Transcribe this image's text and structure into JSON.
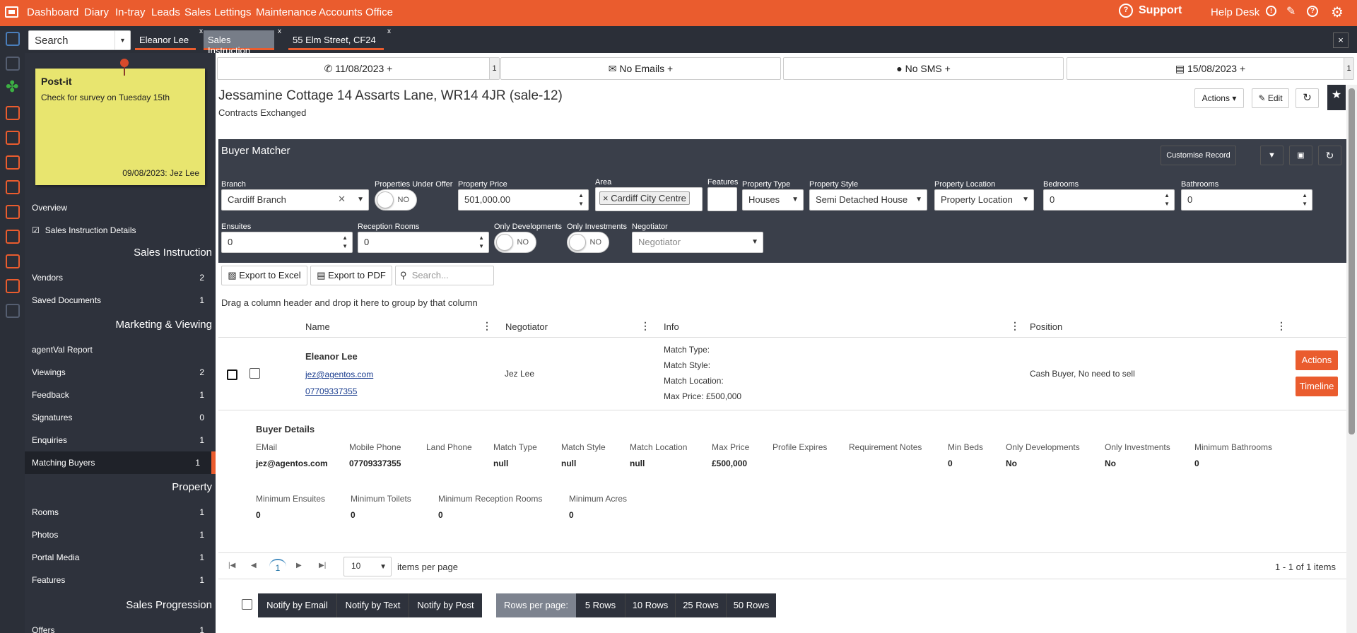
{
  "topnav": {
    "items": [
      "Dashboard",
      "Diary",
      "In-tray",
      "Leads",
      "Sales",
      "Lettings",
      "Maintenance",
      "Accounts",
      "Office"
    ],
    "support": "Support",
    "help_desk": "Help Desk"
  },
  "tabs": {
    "search_placeholder": "Search",
    "items": [
      "Eleanor Lee",
      "Sales Instruction",
      "55 Elm Street, CF24"
    ],
    "close_all": "×"
  },
  "postit": {
    "title": "Post-it",
    "text": "Check for survey on Tuesday 15th",
    "footer": "09/08/2023: Jez Lee"
  },
  "sidebar": {
    "top": [
      {
        "label": "Overview"
      },
      {
        "label": "Sales Instruction Details"
      }
    ],
    "sections": [
      {
        "title": "Sales Instruction",
        "items": [
          {
            "label": "Vendors",
            "count": "2"
          },
          {
            "label": "Saved Documents",
            "count": "1"
          }
        ]
      },
      {
        "title": "Marketing & Viewing",
        "items": [
          {
            "label": "agentVal Report",
            "count": ""
          },
          {
            "label": "Viewings",
            "count": "2"
          },
          {
            "label": "Feedback",
            "count": "1"
          },
          {
            "label": "Signatures",
            "count": "0"
          },
          {
            "label": "Enquiries",
            "count": "1"
          },
          {
            "label": "Matching Buyers",
            "count": "1"
          }
        ]
      },
      {
        "title": "Property",
        "items": [
          {
            "label": "Rooms",
            "count": "1"
          },
          {
            "label": "Photos",
            "count": "1"
          },
          {
            "label": "Portal Media",
            "count": "1"
          },
          {
            "label": "Features",
            "count": "1"
          }
        ]
      },
      {
        "title": "Sales Progression",
        "items": [
          {
            "label": "Offers",
            "count": "1"
          }
        ]
      }
    ]
  },
  "actionbar": {
    "call": "11/08/2023 +",
    "call_count": "1",
    "emails": "No Emails +",
    "sms": "No SMS +",
    "diary": "15/08/2023 +",
    "diary_count": "1"
  },
  "property": {
    "title": "Jessamine Cottage 14 Assarts Lane, WR14 4JR (sale-12)",
    "status": "Contracts Exchanged",
    "actions": "Actions",
    "edit": "Edit"
  },
  "matcher": {
    "title": "Buyer Matcher",
    "customise": "Customise Record",
    "filters": {
      "branch": {
        "label": "Branch",
        "value": "Cardiff Branch"
      },
      "under_offer": {
        "label": "Properties Under Offer",
        "value": "NO"
      },
      "price": {
        "label": "Property Price",
        "value": "501,000.00"
      },
      "area": {
        "label": "Area",
        "value": "Cardiff City Centre"
      },
      "features": {
        "label": "Features",
        "value": ""
      },
      "type": {
        "label": "Property Type",
        "value": "Houses"
      },
      "style": {
        "label": "Property Style",
        "value": "Semi Detached House"
      },
      "location": {
        "label": "Property Location",
        "value": "Property Location"
      },
      "bedrooms": {
        "label": "Bedrooms",
        "value": "0"
      },
      "bathrooms": {
        "label": "Bathrooms",
        "value": "0"
      },
      "ensuites": {
        "label": "Ensuites",
        "value": "0"
      },
      "reception": {
        "label": "Reception Rooms",
        "value": "0"
      },
      "only_dev": {
        "label": "Only Developments",
        "value": "NO"
      },
      "only_inv": {
        "label": "Only Investments",
        "value": "NO"
      },
      "negotiator": {
        "label": "Negotiator",
        "value": "Negotiator"
      }
    }
  },
  "toolbar": {
    "excel": "Export to Excel",
    "pdf": "Export to PDF",
    "search_placeholder": "Search...",
    "drag_hint": "Drag a column header and drop it here to group by that column"
  },
  "grid": {
    "columns": [
      "Name",
      "Negotiator",
      "Info",
      "Position"
    ],
    "row": {
      "name": "Eleanor Lee",
      "email": "jez@agentos.com",
      "phone": "07709337355",
      "negotiator": "Jez Lee",
      "info": [
        "Match Type:",
        "Match Style:",
        "Match Location:",
        "Max Price: £500,000"
      ],
      "position": "Cash Buyer, No need to sell",
      "actions": "Actions",
      "timeline": "Timeline"
    }
  },
  "buyer_details": {
    "title": "Buyer Details",
    "row1": [
      {
        "label": "EMail",
        "value": "jez@agentos.com"
      },
      {
        "label": "Mobile Phone",
        "value": "07709337355"
      },
      {
        "label": "Land Phone",
        "value": ""
      },
      {
        "label": "Match Type",
        "value": "null"
      },
      {
        "label": "Match Style",
        "value": "null"
      },
      {
        "label": "Match Location",
        "value": "null"
      },
      {
        "label": "Max Price",
        "value": "£500,000"
      },
      {
        "label": "Profile Expires",
        "value": ""
      },
      {
        "label": "Requirement Notes",
        "value": ""
      },
      {
        "label": "Min Beds",
        "value": "0"
      },
      {
        "label": "Only Developments",
        "value": "No"
      },
      {
        "label": "Only Investments",
        "value": "No"
      },
      {
        "label": "Minimum Bathrooms",
        "value": "0"
      }
    ],
    "row2": [
      {
        "label": "Minimum Ensuites",
        "value": "0"
      },
      {
        "label": "Minimum Toilets",
        "value": "0"
      },
      {
        "label": "Minimum Reception Rooms",
        "value": "0"
      },
      {
        "label": "Minimum Acres",
        "value": "0"
      }
    ]
  },
  "pager": {
    "page": "1",
    "per_page": "10",
    "per_page_label": "items per page",
    "summary": "1 - 1 of 1 items"
  },
  "bottom": {
    "notify_email": "Notify by Email",
    "notify_text": "Notify by Text",
    "notify_post": "Notify by Post",
    "rows_label": "Rows per page:",
    "rows": [
      "5 Rows",
      "10 Rows",
      "25 Rows",
      "50 Rows"
    ]
  },
  "colors": {
    "accent": "#ea5c2e",
    "dark": "#2e323c",
    "panel": "#3a3f4a"
  }
}
